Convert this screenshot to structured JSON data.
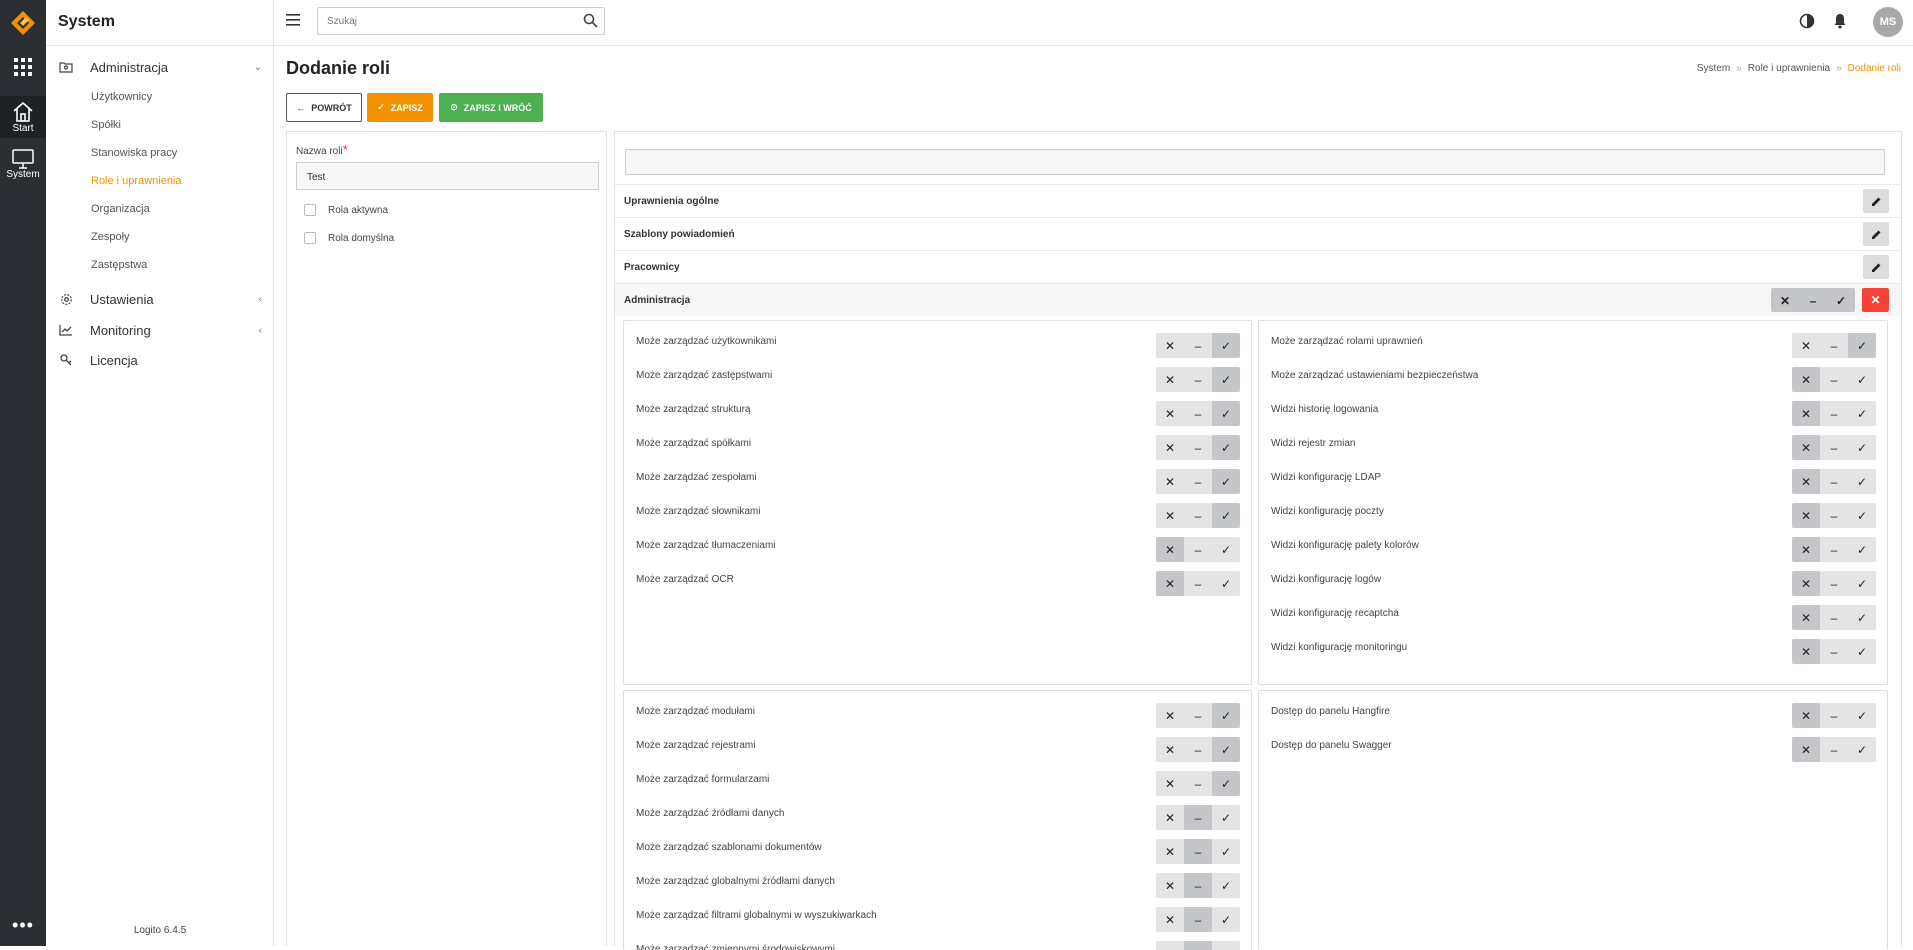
{
  "app": {
    "version": "Logito 6.4.5",
    "section_title": "System"
  },
  "rail": {
    "start_label": "Start",
    "system_label": "System"
  },
  "sidebar": {
    "groups": [
      {
        "label": "Administracja",
        "icon": "folder-user-icon",
        "expanded": true
      },
      {
        "label": "Ustawienia",
        "icon": "gear-icon",
        "expanded": false
      },
      {
        "label": "Monitoring",
        "icon": "chart-icon",
        "expanded": false
      },
      {
        "label": "Licencja",
        "icon": "key-icon",
        "expanded": false
      }
    ],
    "admin_items": [
      "Użytkownicy",
      "Spółki",
      "Stanowiska pracy",
      "Role i uprawnienia",
      "Organizacja",
      "Zespoły",
      "Zastępstwa"
    ],
    "active_item": "Role i uprawnienia"
  },
  "topbar": {
    "search_placeholder": "Szukaj",
    "avatar_initials": "MS"
  },
  "page": {
    "title": "Dodanie roli",
    "breadcrumb": [
      "System",
      "Role i uprawnienia",
      "Dodanie roli"
    ],
    "buttons": {
      "back": "POWRÓT",
      "save": "ZAPISZ",
      "save_back": "ZAPISZ I WRÓĆ"
    }
  },
  "form": {
    "name_label": "Nazwa roli",
    "name_value": "Test",
    "checkboxes": [
      {
        "label": "Rola aktywna",
        "checked": false
      },
      {
        "label": "Rola domyślna",
        "checked": false
      }
    ]
  },
  "permissions": {
    "sections": [
      "Uprawnienia ogólne",
      "Szablony powiadomień",
      "Pracownicy",
      "Administracja"
    ],
    "admin_group_state": "none",
    "box1": [
      {
        "label": "Może zarządzać użytkownikami",
        "state": "allow"
      },
      {
        "label": "Może zarządzać zastępstwami",
        "state": "allow"
      },
      {
        "label": "Może zarządzać strukturą",
        "state": "allow"
      },
      {
        "label": "Może zarządzać spółkami",
        "state": "allow"
      },
      {
        "label": "Może zarządzać zespołami",
        "state": "allow"
      },
      {
        "label": "Może zarządzać słownikami",
        "state": "allow"
      },
      {
        "label": "Może zarządzać tłumaczeniami",
        "state": "deny"
      },
      {
        "label": "Może zarządzać OCR",
        "state": "deny"
      }
    ],
    "box2": [
      {
        "label": "Może zarządzać rolami uprawnień",
        "state": "allow"
      },
      {
        "label": "Może zarządzać ustawieniami bezpieczeństwa",
        "state": "deny"
      },
      {
        "label": "Widzi historię logowania",
        "state": "deny"
      },
      {
        "label": "Widzi rejestr zmian",
        "state": "deny"
      },
      {
        "label": "Widzi konfigurację LDAP",
        "state": "deny"
      },
      {
        "label": "Widzi konfigurację poczty",
        "state": "deny"
      },
      {
        "label": "Widzi konfigurację palety kolorów",
        "state": "deny"
      },
      {
        "label": "Widzi konfigurację logów",
        "state": "deny"
      },
      {
        "label": "Widzi konfigurację recaptcha",
        "state": "deny"
      },
      {
        "label": "Widzi konfigurację monitoringu",
        "state": "deny"
      }
    ],
    "box3": [
      {
        "label": "Może zarządzać modułami",
        "state": "allow"
      },
      {
        "label": "Może zarządzać rejestrami",
        "state": "allow"
      },
      {
        "label": "Może zarządzać formularzami",
        "state": "allow"
      },
      {
        "label": "Może zarządzać źródłami danych",
        "state": "inherit"
      },
      {
        "label": "Może zarządzać szablonami dokumentów",
        "state": "inherit"
      },
      {
        "label": "Może zarządzać globalnymi źródłami danych",
        "state": "inherit"
      },
      {
        "label": "Może zarządzać filtrami globalnymi w wyszukiwarkach",
        "state": "inherit"
      },
      {
        "label": "Może zarządzać zmiennymi środowiskowymi",
        "state": "inherit"
      }
    ],
    "box4": [
      {
        "label": "Dostęp do panelu Hangfire",
        "state": "deny"
      },
      {
        "label": "Dostęp do panelu Swagger",
        "state": "deny"
      }
    ]
  },
  "colors": {
    "accent": "#f39200",
    "success": "#4caf50",
    "danger": "#f44336",
    "rail": "#2b2e33"
  }
}
